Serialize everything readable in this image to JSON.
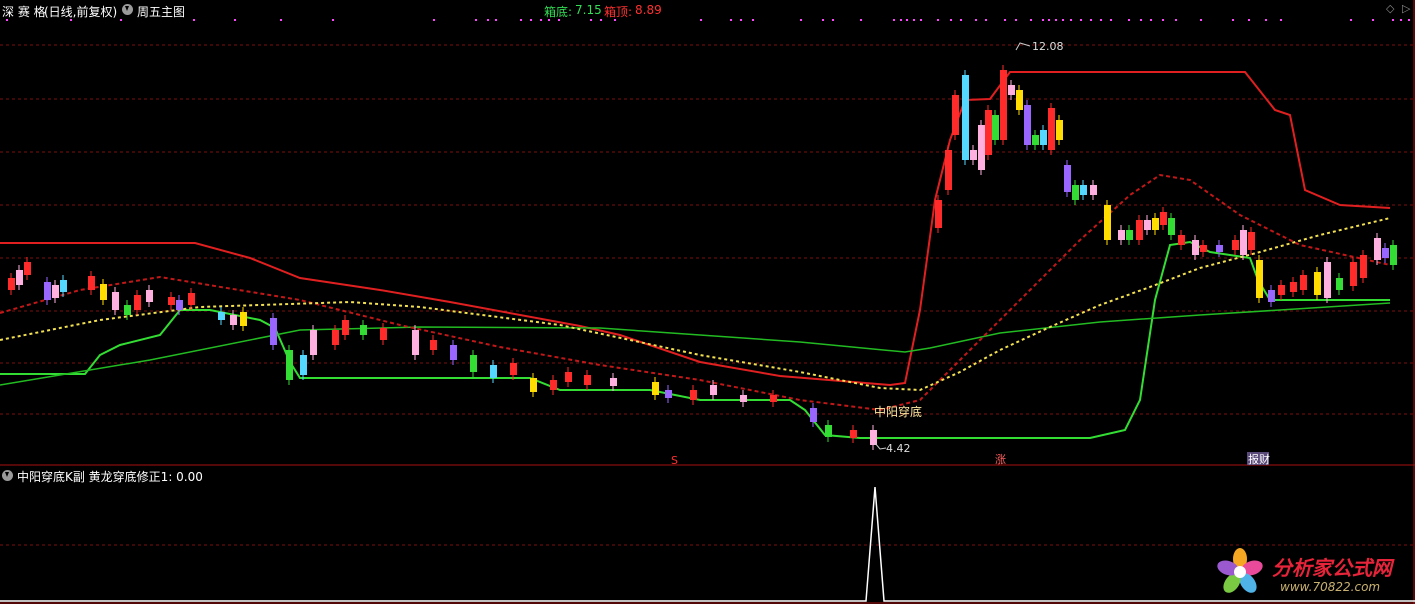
{
  "header": {
    "stock_name": "深 赛 格",
    "period": "(日线,前复权)",
    "template_name": "周五主图",
    "box_bottom_label": "箱底:",
    "box_bottom_value": "7.15",
    "box_top_label": "箱顶:",
    "box_top_value": "8.89"
  },
  "sub_panel": {
    "title": "中阳穿底K副 黄龙穿底修正1: 0.00"
  },
  "annotations": {
    "high_price": "12.08",
    "low_price": "4.42",
    "pattern_label": "中阳穿底",
    "marker_s": "S",
    "marker_zhang": "涨",
    "marker_caibao": "报财"
  },
  "watermark": {
    "site_name": "分析家公式网",
    "url": "www.70822.com"
  },
  "colors": {
    "box_top_line": "#e02020",
    "box_bottom_line": "#33dd33",
    "grid": "#7a1010",
    "candle_up": "#ff2a2a",
    "candle_down": "#55d8ff",
    "text_green": "#33dd55",
    "text_red": "#ff3030"
  }
}
